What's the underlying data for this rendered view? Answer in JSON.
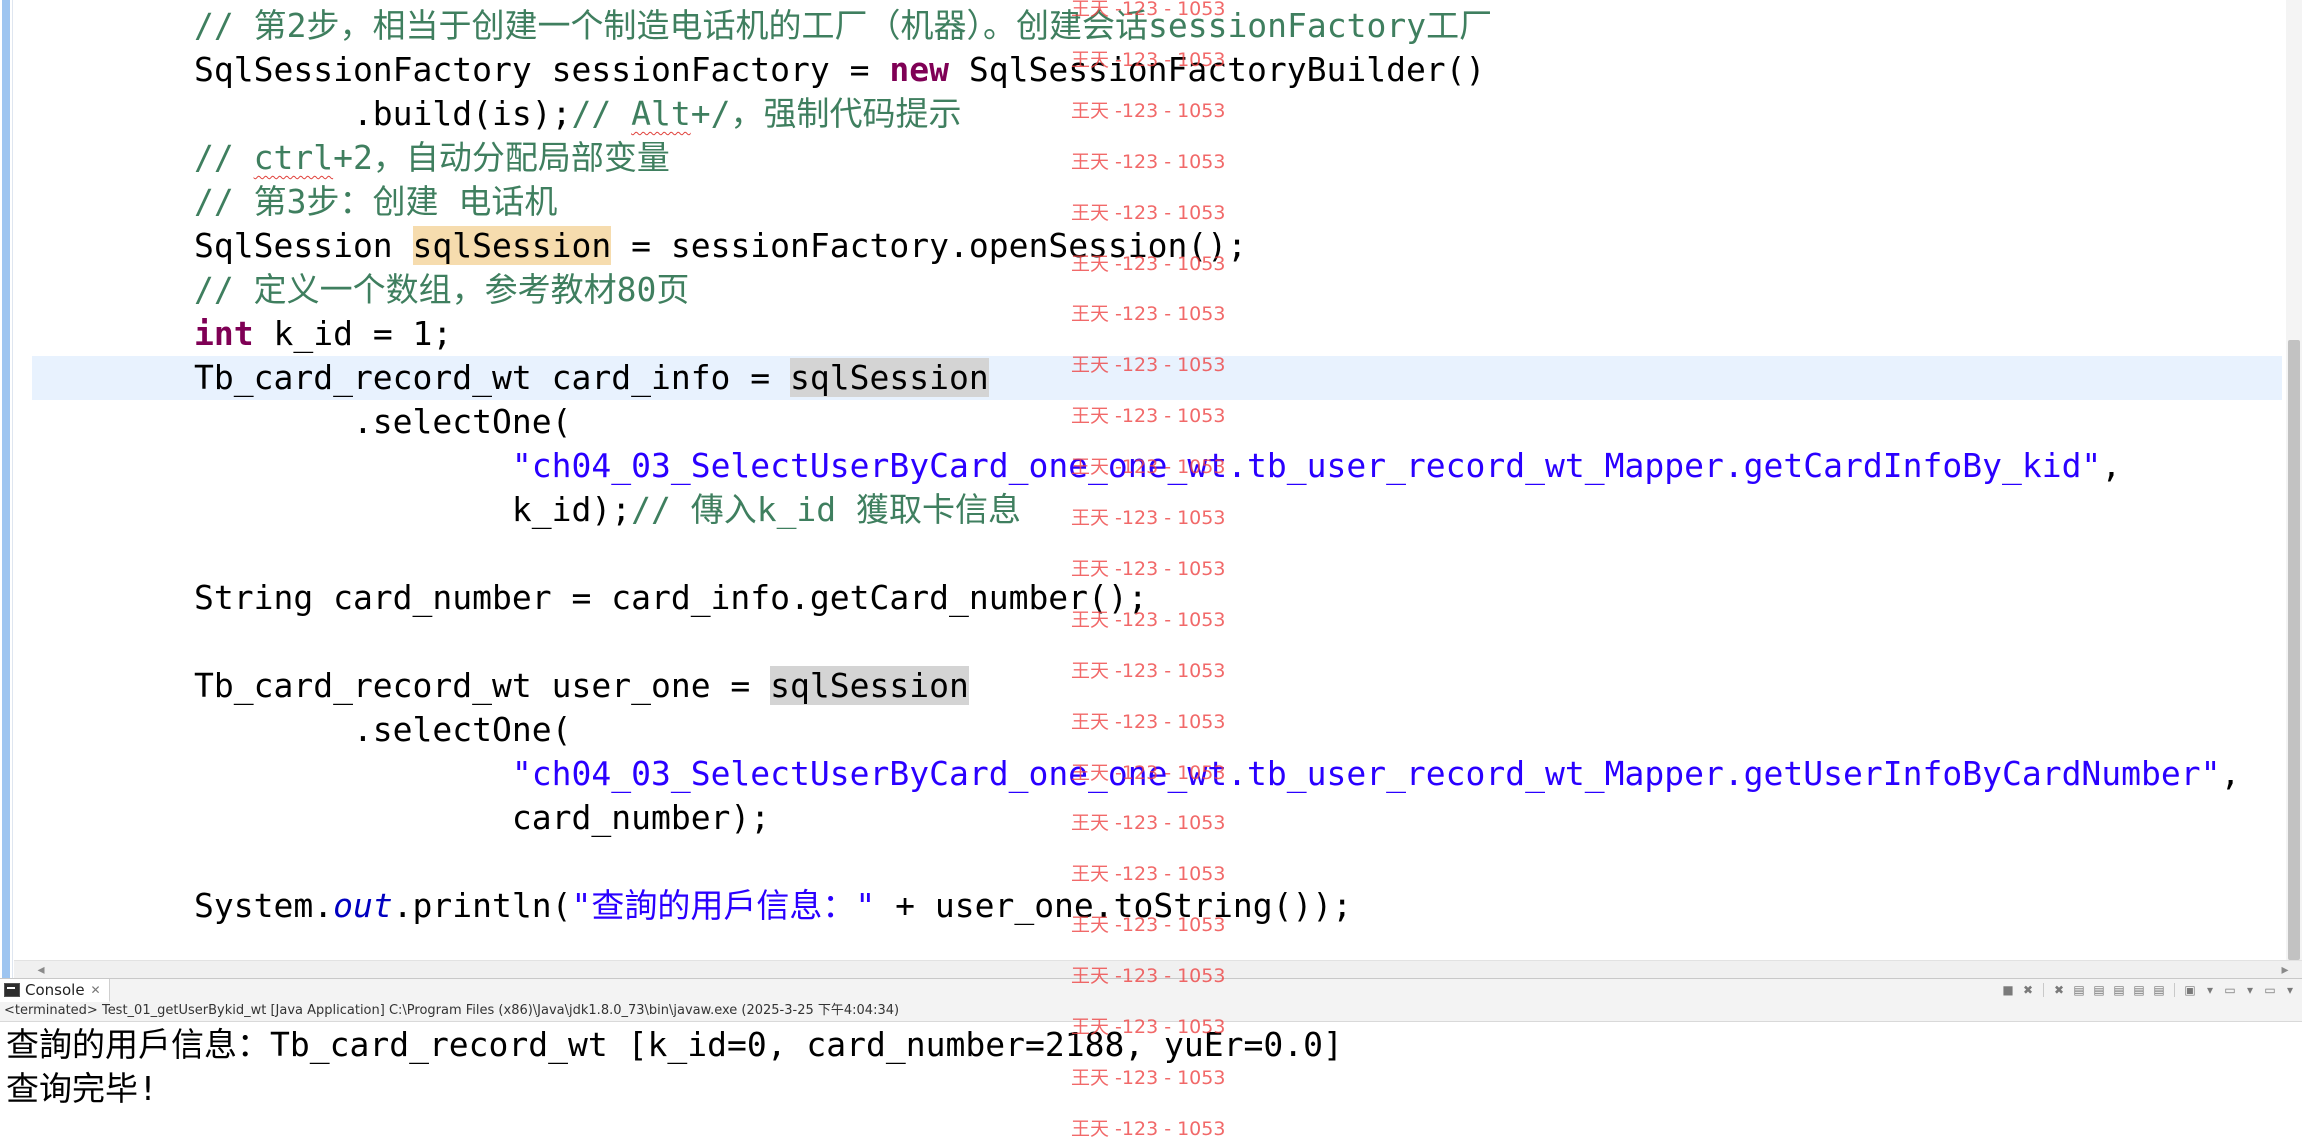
{
  "editor": {
    "lines": [
      {
        "segments": [
          {
            "t": "// 第2步，相当于创建一个制造电话机的工厂（机器）。创建会话sessionFactory工厂",
            "c": "cm"
          }
        ]
      },
      {
        "segments": [
          {
            "t": "SqlSessionFactory sessionFactory = ",
            "c": ""
          },
          {
            "t": "new",
            "c": "kw"
          },
          {
            "t": " SqlSessionFactoryBuilder()",
            "c": ""
          }
        ]
      },
      {
        "segments": [
          {
            "t": "        .build(is);",
            "c": ""
          },
          {
            "t": "// ",
            "c": "cm"
          },
          {
            "t": "Alt",
            "c": "cm squig"
          },
          {
            "t": "+/，强制代码提示",
            "c": "cm"
          }
        ]
      },
      {
        "segments": [
          {
            "t": "// ",
            "c": "cm"
          },
          {
            "t": "ctrl",
            "c": "cm squig"
          },
          {
            "t": "+2，自动分配局部变量",
            "c": "cm"
          }
        ]
      },
      {
        "segments": [
          {
            "t": "// 第3步：创建 电话机",
            "c": "cm"
          }
        ]
      },
      {
        "segments": [
          {
            "t": "SqlSession ",
            "c": ""
          },
          {
            "t": "sqlSession",
            "c": "occ"
          },
          {
            "t": " = sessionFactory.openSession();",
            "c": ""
          }
        ]
      },
      {
        "segments": [
          {
            "t": "// 定义一个数组，参考教材80页",
            "c": "cm"
          }
        ]
      },
      {
        "segments": [
          {
            "t": "int",
            "c": "kw"
          },
          {
            "t": " k_id = 1;",
            "c": ""
          }
        ]
      },
      {
        "segments": [
          {
            "t": "Tb_card_record_wt card_info = ",
            "c": ""
          },
          {
            "t": "sqlSession",
            "c": "occ2"
          }
        ],
        "current": true
      },
      {
        "segments": [
          {
            "t": "        .selectOne(",
            "c": ""
          }
        ]
      },
      {
        "segments": [
          {
            "t": "                ",
            "c": ""
          },
          {
            "t": "\"ch04_03_SelectUserByCard_one_one_wt.tb_user_record_wt_Mapper.getCardInfoBy_kid\"",
            "c": "st"
          },
          {
            "t": ",",
            "c": ""
          }
        ]
      },
      {
        "segments": [
          {
            "t": "                k_id);",
            "c": ""
          },
          {
            "t": "// 傳入k_id 獲取卡信息",
            "c": "cm"
          }
        ]
      },
      {
        "segments": [
          {
            "t": "",
            "c": ""
          }
        ]
      },
      {
        "segments": [
          {
            "t": "String card_number = card_info.getCard_number();",
            "c": ""
          }
        ]
      },
      {
        "segments": [
          {
            "t": "",
            "c": ""
          }
        ]
      },
      {
        "segments": [
          {
            "t": "Tb_card_record_wt user_one = ",
            "c": ""
          },
          {
            "t": "sqlSession",
            "c": "occ2"
          }
        ]
      },
      {
        "segments": [
          {
            "t": "        .selectOne(",
            "c": ""
          }
        ]
      },
      {
        "segments": [
          {
            "t": "                ",
            "c": ""
          },
          {
            "t": "\"ch04_03_SelectUserByCard_one_one_wt.tb_user_record_wt_Mapper.getUserInfoByCardNumber\"",
            "c": "st"
          },
          {
            "t": ",",
            "c": ""
          }
        ]
      },
      {
        "segments": [
          {
            "t": "                card_number);",
            "c": ""
          }
        ]
      },
      {
        "segments": [
          {
            "t": "",
            "c": ""
          }
        ]
      },
      {
        "segments": [
          {
            "t": "System.",
            "c": ""
          },
          {
            "t": "out",
            "c": "fld"
          },
          {
            "t": ".println(",
            "c": ""
          },
          {
            "t": "\"查詢的用戶信息：\"",
            "c": "st"
          },
          {
            "t": " + user_one.toString());",
            "c": ""
          }
        ]
      }
    ]
  },
  "console": {
    "tab_label": "Console",
    "tab_close": "✕",
    "description": "<terminated> Test_01_getUserBykid_wt [Java Application] C:\\Program Files (x86)\\Java\\jdk1.8.0_73\\bin\\javaw.exe (2025-3-25 下午4:04:34)",
    "output": [
      "查詢的用戶信息：Tb_card_record_wt [k_id=0, card_number=2188, yuEr=0.0]",
      "查询完毕!"
    ],
    "toolbar_icons": [
      "■",
      "✖",
      "✖",
      "▤",
      "▤",
      "▤",
      "▤",
      "▤",
      "▣",
      "▾",
      "▭",
      "▾",
      "▭",
      "▾"
    ]
  },
  "watermark": {
    "text": "王天 -123 - 1053",
    "color": "#ee4444",
    "count": 23
  },
  "scroll": {
    "left_arrow": "◂",
    "right_arrow": "▸"
  }
}
